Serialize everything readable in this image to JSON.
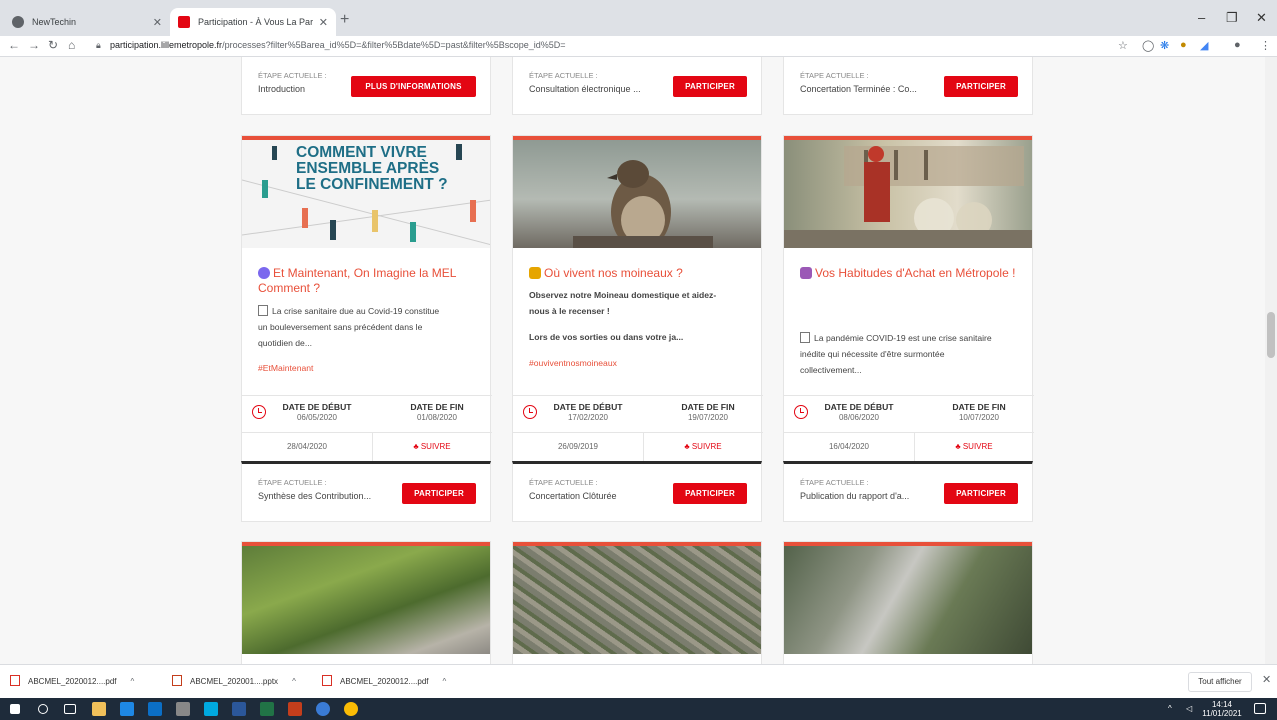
{
  "browser": {
    "tabs": [
      {
        "title": "NewTechin",
        "active": false
      },
      {
        "title": "Participation - À Vous La Parole !",
        "active": true
      }
    ],
    "url_host": "participation.lillemetropole.fr",
    "url_path": "/processes?filter%5Barea_id%5D=&filter%5Bdate%5D=past&filter%5Bscope_id%5D=",
    "close_glyph": "✕",
    "new_tab_glyph": "+"
  },
  "top_steps": [
    {
      "label": "ÉTAPE ACTUELLE :",
      "value": "Introduction",
      "button": "PLUS D'INFORMATIONS"
    },
    {
      "label": "ÉTAPE ACTUELLE :",
      "value": "Consultation électronique ...",
      "button": "PARTICIPER"
    },
    {
      "label": "ÉTAPE ACTUELLE :",
      "value": "Concertation Terminée : Co...",
      "button": "PARTICIPER"
    }
  ],
  "cards": [
    {
      "image_text": [
        "COMMENT VIVRE",
        "ENSEMBLE APRÈS",
        "LE CONFINEMENT ?"
      ],
      "title": "Et Maintenant, On Imagine la MEL Comment ?",
      "desc": [
        "La crise sanitaire due au Covid-19 constitue",
        "un bouleversement sans précédent dans le",
        "quotidien de..."
      ],
      "tag": "#EtMaintenant",
      "start_label": "DATE DE DÉBUT",
      "start": "06/05/2020",
      "end_label": "DATE DE FIN",
      "end": "01/08/2020",
      "published": "28/04/2020",
      "follow": "SUIVRE",
      "step_label": "ÉTAPE ACTUELLE :",
      "step_value": "Synthèse des Contribution...",
      "button": "PARTICIPER"
    },
    {
      "title": "Où vivent nos moineaux ?",
      "desc": [
        "Observez notre Moineau domestique et aidez-",
        "nous à le recenser !",
        "Lors de vos sorties ou dans votre ja..."
      ],
      "tag": "#ouviventnosmoineaux",
      "start_label": "DATE DE DÉBUT",
      "start": "17/02/2020",
      "end_label": "DATE DE FIN",
      "end": "19/07/2020",
      "published": "26/09/2019",
      "follow": "SUIVRE",
      "step_label": "ÉTAPE ACTUELLE :",
      "step_value": "Concertation Clôturée",
      "button": "PARTICIPER"
    },
    {
      "title": "Vos Habitudes d'Achat en Métropole !",
      "desc": [
        "La pandémie COVID-19 est une crise sanitaire",
        "inédite qui nécessite d'être surmontée",
        "collectivement..."
      ],
      "start_label": "DATE DE DÉBUT",
      "start": "08/06/2020",
      "end_label": "DATE DE FIN",
      "end": "10/07/2020",
      "published": "16/04/2020",
      "follow": "SUIVRE",
      "step_label": "ÉTAPE ACTUELLE :",
      "step_value": "Publication du rapport d'a...",
      "button": "PARTICIPER"
    }
  ],
  "downloads": [
    {
      "name": "ABCMEL_2020012....pdf"
    },
    {
      "name": "ABCMEL_202001....pptx"
    },
    {
      "name": "ABCMEL_2020012....pdf"
    }
  ],
  "show_all": "Tout afficher",
  "clock": {
    "time": "14:14",
    "date": "11/01/2021"
  },
  "colors": {
    "accent": "#e30613",
    "title": "#e8503a",
    "taskbar": "#1e2b3a"
  }
}
